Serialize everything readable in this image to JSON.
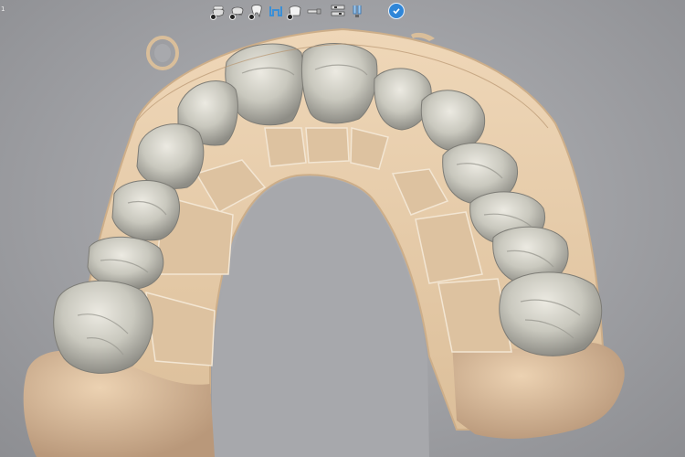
{
  "app": {
    "corner_label": "1"
  },
  "toolbar": {
    "tools": [
      {
        "name": "lower-jaw-tool",
        "icon": "lower-jaw-icon"
      },
      {
        "name": "upper-jaw-tool",
        "icon": "upper-jaw-icon"
      },
      {
        "name": "single-tooth-tool",
        "icon": "tooth-icon"
      },
      {
        "name": "gingiva-tool",
        "icon": "gingiva-icon"
      },
      {
        "name": "crown-tool",
        "icon": "crown-icon"
      },
      {
        "name": "implant-tool",
        "icon": "implant-icon"
      },
      {
        "name": "align-tool",
        "icon": "align-icon"
      },
      {
        "name": "attachment-tool",
        "icon": "attachment-icon"
      }
    ],
    "confirm": {
      "icon": "checkmark-icon"
    }
  },
  "colors": {
    "background": "#a3a4a8",
    "gingiva": "#e9cfae",
    "tooth": "#cfcec4",
    "accent": "#2f86d8"
  }
}
